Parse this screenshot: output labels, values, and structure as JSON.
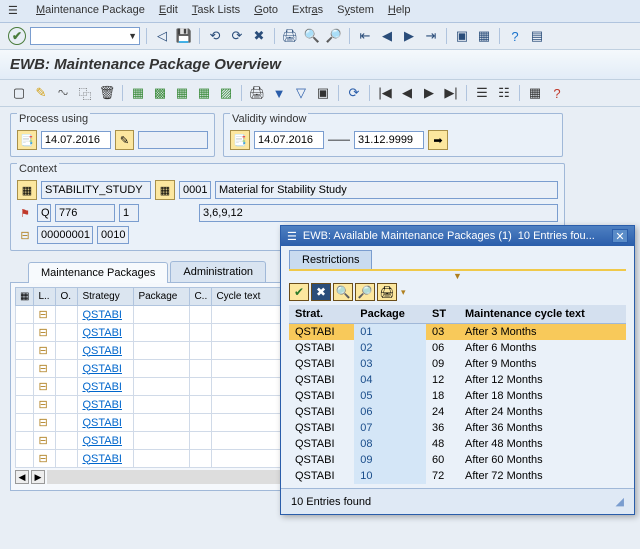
{
  "menu": {
    "items": [
      "Maintenance Package",
      "Edit",
      "Task Lists",
      "Goto",
      "Extras",
      "System",
      "Help"
    ]
  },
  "title": "EWB: Maintenance Package Overview",
  "process": {
    "label": "Process using",
    "date": "14.07.2016",
    "extra": ""
  },
  "validity": {
    "label": "Validity window",
    "from": "14.07.2016",
    "to": "31.12.9999"
  },
  "context": {
    "label": "Context",
    "study": "STABILITY_STUDY",
    "code1": "0001",
    "desc": "Material for Stability Study",
    "q": "Q",
    "num": "776",
    "sub": "1",
    "seq": "3,6,9,12",
    "id1": "00000001",
    "id2": "0010"
  },
  "tabs": {
    "t1": "Maintenance Packages",
    "t2": "Administration"
  },
  "grid": {
    "cols": {
      "l": "L..",
      "o": "O.",
      "strat": "Strategy",
      "pkg": "Package",
      "c": "C..",
      "ct": "Cycle text"
    },
    "strategy": "QSTABI"
  },
  "popup": {
    "title": "EWB: Available Maintenance Packages (1)",
    "subtitle": "10 Entries fou...",
    "tab": "Restrictions",
    "cols": {
      "strat": "Strat.",
      "pkg": "Package",
      "st": "ST",
      "mct": "Maintenance cycle text"
    },
    "rows": [
      {
        "strat": "QSTABI",
        "pkg": "01",
        "st": "03",
        "txt": "After 3 Months"
      },
      {
        "strat": "QSTABI",
        "pkg": "02",
        "st": "06",
        "txt": "After 6 Months"
      },
      {
        "strat": "QSTABI",
        "pkg": "03",
        "st": "09",
        "txt": "After 9 Months"
      },
      {
        "strat": "QSTABI",
        "pkg": "04",
        "st": "12",
        "txt": "After 12 Months"
      },
      {
        "strat": "QSTABI",
        "pkg": "05",
        "st": "18",
        "txt": "After 18 Months"
      },
      {
        "strat": "QSTABI",
        "pkg": "06",
        "st": "24",
        "txt": "After 24 Months"
      },
      {
        "strat": "QSTABI",
        "pkg": "07",
        "st": "36",
        "txt": "After 36 Months"
      },
      {
        "strat": "QSTABI",
        "pkg": "08",
        "st": "48",
        "txt": "After 48 Months"
      },
      {
        "strat": "QSTABI",
        "pkg": "09",
        "st": "60",
        "txt": "After 60 Months"
      },
      {
        "strat": "QSTABI",
        "pkg": "10",
        "st": "72",
        "txt": "After 72 Months"
      }
    ],
    "status": "10 Entries found"
  }
}
